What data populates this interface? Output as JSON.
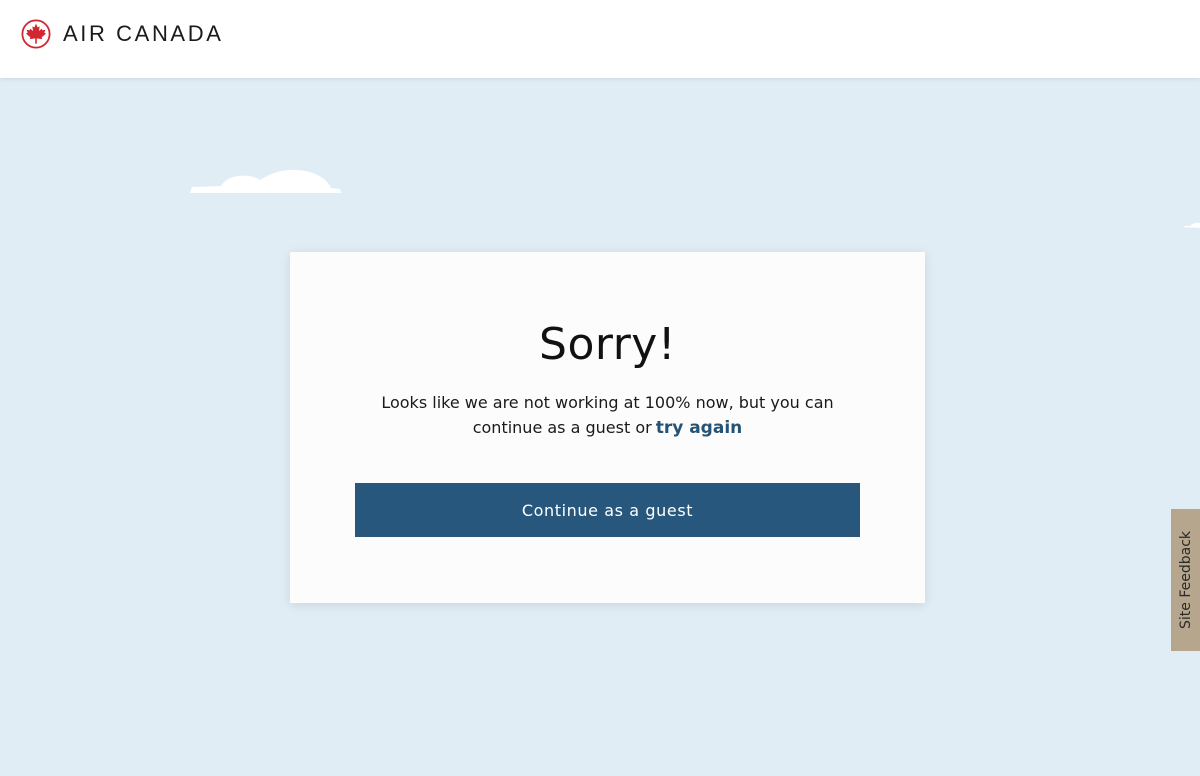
{
  "header": {
    "logo_text": "AIR CANADA",
    "logo_icon": "maple-leaf-roundel-icon"
  },
  "dialog": {
    "title": "Sorry!",
    "message": "Looks like we are not working at 100% now, but you can continue as a guest or",
    "retry_link": "try again",
    "continue_button": "Continue as a guest"
  },
  "feedback": {
    "label": "Site Feedback"
  },
  "colors": {
    "background": "#e1edf5",
    "brand_red": "#d22630",
    "button": "#27577c",
    "link": "#255376",
    "feedback_tab": "#b7a68e"
  }
}
